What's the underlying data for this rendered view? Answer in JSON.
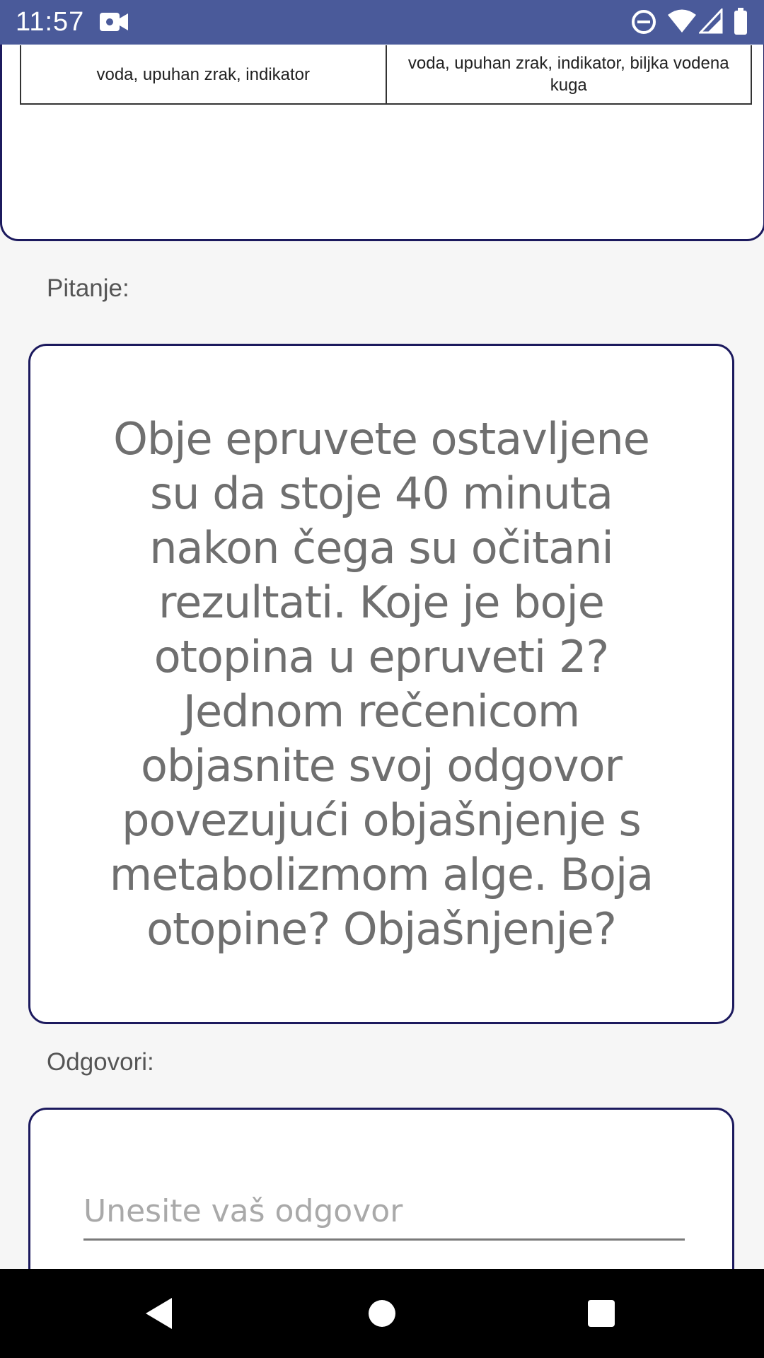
{
  "status_bar": {
    "time": "11:57",
    "icons": [
      "video-camera-icon",
      "do-not-disturb-icon",
      "wifi-icon",
      "signal-icon",
      "battery-icon"
    ]
  },
  "image_table": {
    "cells": [
      "voda, upuhan zrak, indikator",
      "voda, upuhan zrak, indikator, biljka vodena kuga"
    ]
  },
  "question": {
    "label": "Pitanje:",
    "text": "Obje epruvete ostavljene su da stoje 40 minuta nakon čega su očitani rezultati. Koje je boje otopina u epruveti 2? Jednom rečenicom objasnite svoj odgovor povezujući objašnjenje s metabolizmom alge. Boja otopine? Objašnjenje?"
  },
  "answer": {
    "label": "Odgovori:",
    "placeholder": "Unesite vaš odgovor",
    "value": ""
  },
  "nav_bar": {
    "buttons": [
      "back-icon",
      "home-icon",
      "recents-icon"
    ]
  },
  "colors": {
    "status_bar": "#4a5a9a",
    "card_border": "#1c1a5e",
    "background": "#f6f6f6"
  }
}
